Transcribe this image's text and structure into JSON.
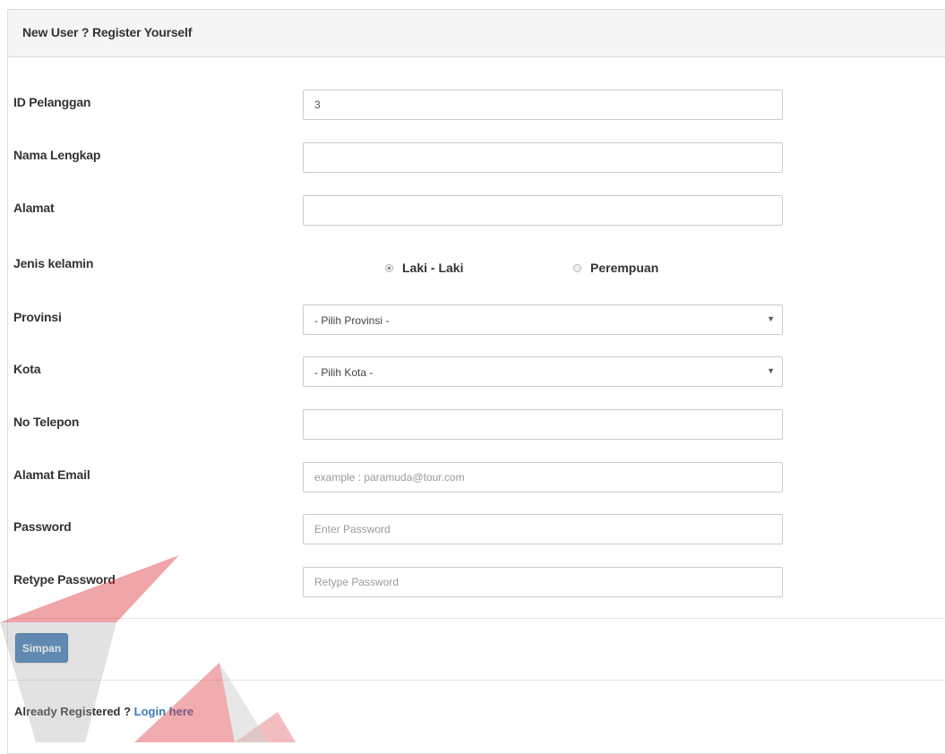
{
  "panel": {
    "title": "New User ? Register Yourself"
  },
  "form": {
    "id_pelanggan": {
      "label": "ID Pelanggan",
      "value": "3",
      "placeholder": ""
    },
    "nama_lengkap": {
      "label": "Nama Lengkap",
      "value": "",
      "placeholder": ""
    },
    "alamat": {
      "label": "Alamat",
      "value": "",
      "placeholder": ""
    },
    "jenis_kelamin": {
      "label": "Jenis kelamin",
      "options": [
        {
          "label": "Laki - Laki",
          "checked": true
        },
        {
          "label": "Perempuan",
          "checked": false
        }
      ]
    },
    "provinsi": {
      "label": "Provinsi",
      "selected": "- Pilih Provinsi -"
    },
    "kota": {
      "label": "Kota",
      "selected": "- Pilih Kota -"
    },
    "no_telepon": {
      "label": "No Telepon",
      "value": "",
      "placeholder": ""
    },
    "alamat_email": {
      "label": "Alamat Email",
      "value": "",
      "placeholder": "example : paramuda@tour.com"
    },
    "password": {
      "label": "Password",
      "value": "",
      "placeholder": "Enter Password"
    },
    "retype_password": {
      "label": "Retype Password",
      "value": "",
      "placeholder": "Retype Password"
    }
  },
  "actions": {
    "submit_label": "Simpan"
  },
  "footer": {
    "prefix": "Already Registered ? ",
    "link_label": "Login here"
  },
  "icons": {
    "select_arrow": "chevron-down-icon"
  },
  "colors": {
    "primary": "#3d7bb6",
    "link": "#3a7ab8",
    "heading_bg": "#f5f5f5",
    "watermark_red": "#d9262e",
    "watermark_gray": "#a8a8a8"
  }
}
